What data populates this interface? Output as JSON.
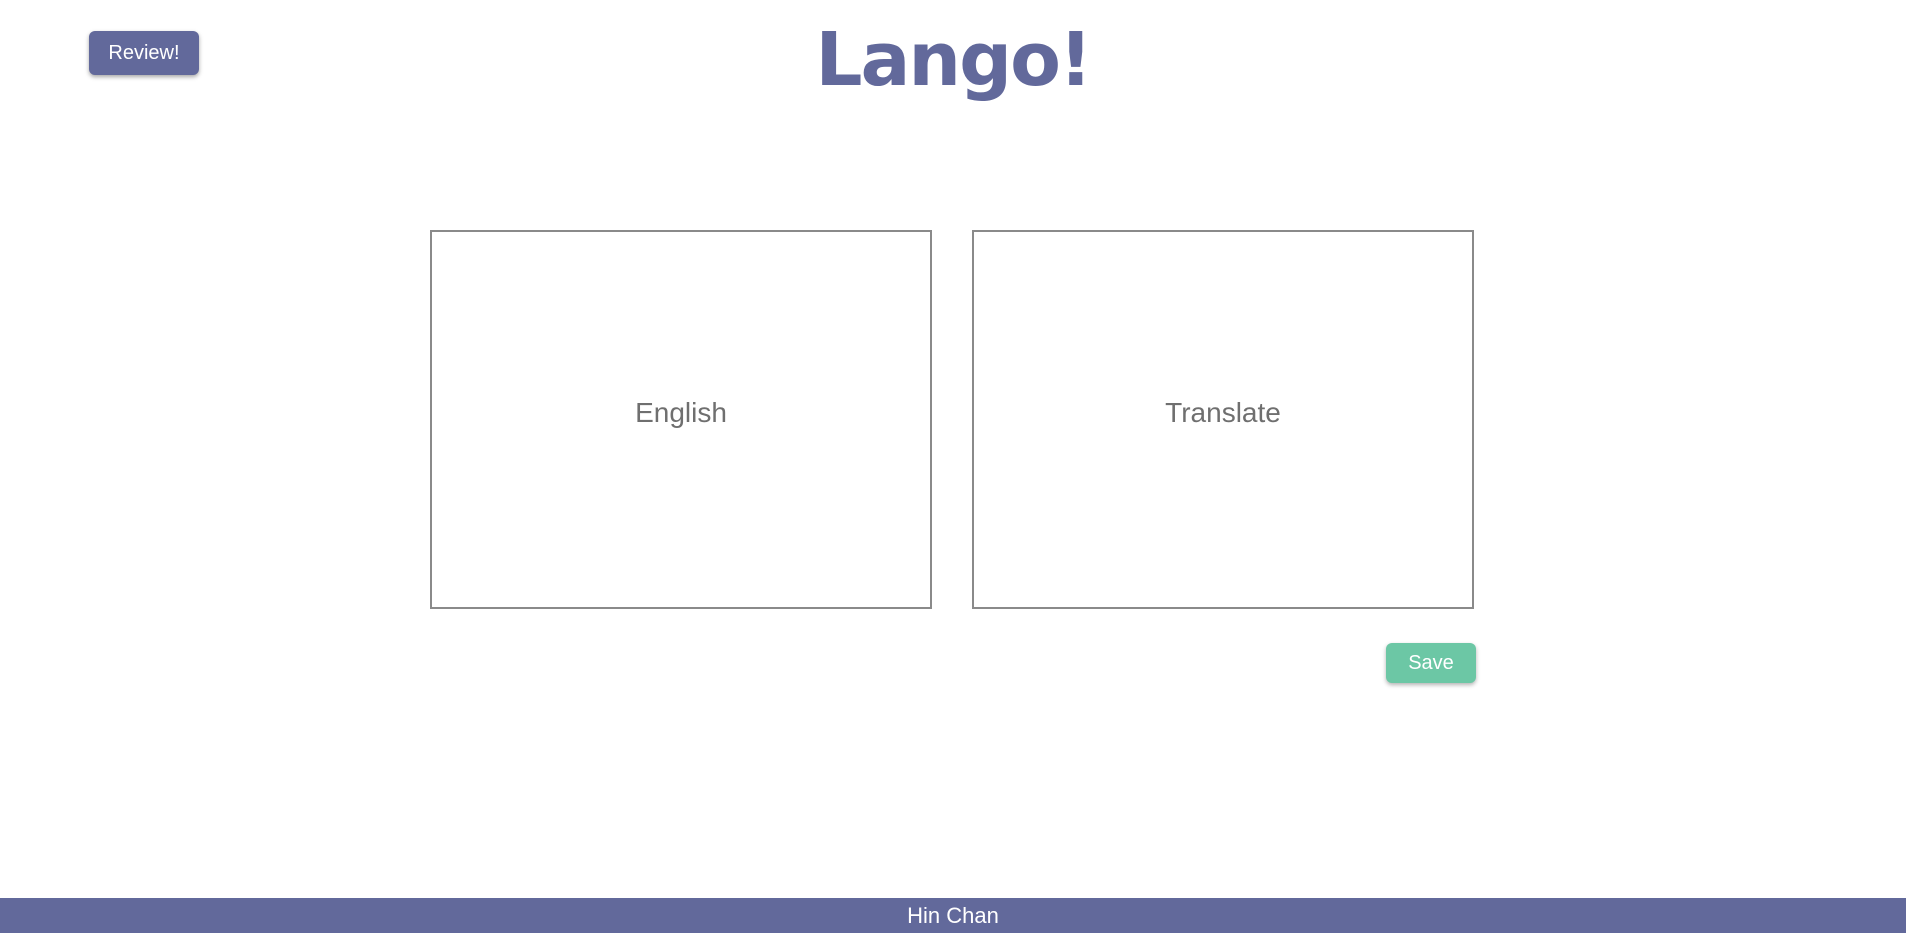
{
  "header": {
    "review_label": "Review!",
    "title": "Lango!"
  },
  "cards": {
    "english_placeholder": "English",
    "translate_placeholder": "Translate"
  },
  "actions": {
    "save_label": "Save"
  },
  "footer": {
    "author": "Hin Chan"
  },
  "colors": {
    "primary": "#62699b",
    "save": "#6cc7a5",
    "box_border": "#8a8a8a",
    "placeholder_text": "#6f6f6f"
  }
}
